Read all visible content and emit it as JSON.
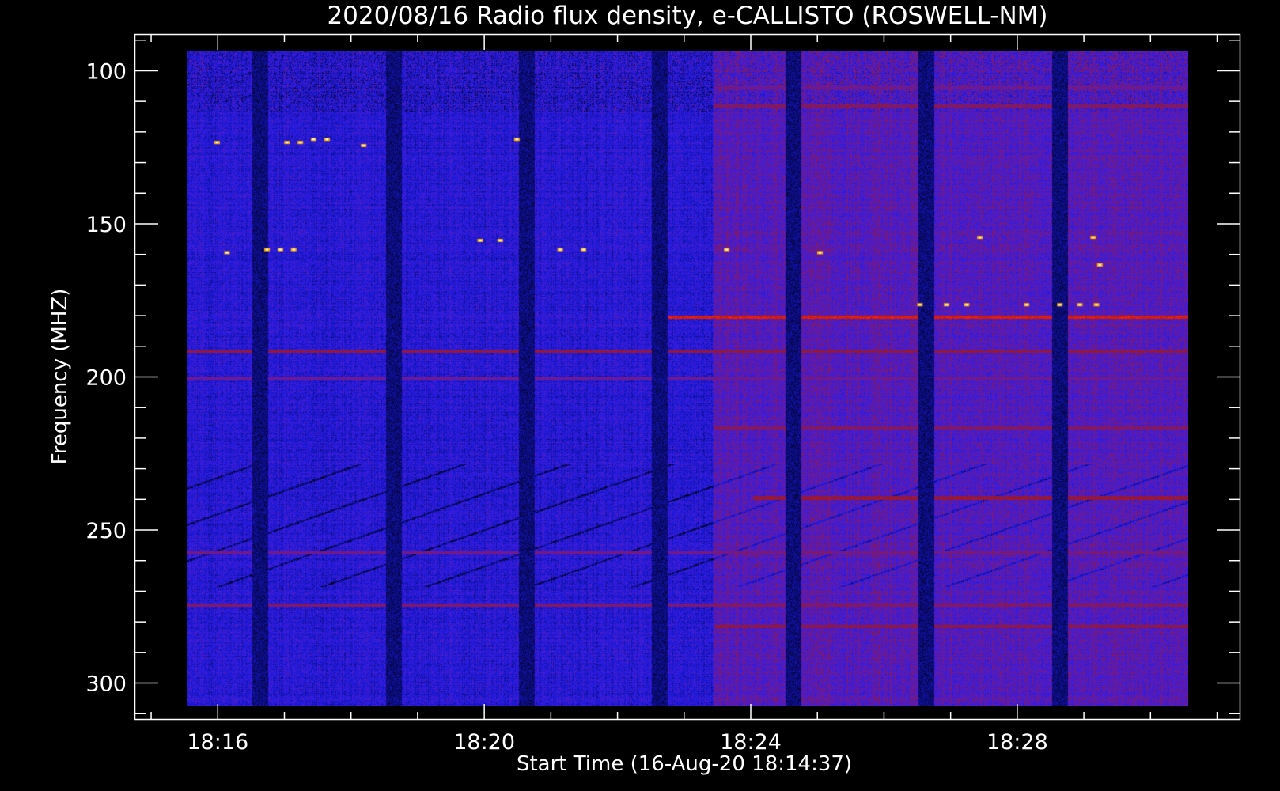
{
  "chart_data": {
    "type": "heatmap",
    "title": "2020/08/16  Radio flux density, e-CALLISTO (ROSWELL-NM)",
    "xlabel": "Start Time (16-Aug-20 18:14:37)",
    "ylabel": "Frequency (MHZ)",
    "xlim_minutes": [
      14.75,
      31.35
    ],
    "ylim_mhz": [
      88,
      312
    ],
    "data_range": {
      "t0_minutes": 15.0,
      "t1_minutes": 30.0,
      "f0_mhz": 90,
      "f1_mhz": 306
    },
    "x_ticks": [
      {
        "minute": 16,
        "label": "18:16"
      },
      {
        "minute": 20,
        "label": "18:20"
      },
      {
        "minute": 24,
        "label": "18:24"
      },
      {
        "minute": 28,
        "label": "18:28"
      }
    ],
    "x_minor_step_minutes": 1,
    "y_ticks": [
      {
        "mhz": 100,
        "label": "100"
      },
      {
        "mhz": 150,
        "label": "150"
      },
      {
        "mhz": 200,
        "label": "200"
      },
      {
        "mhz": 250,
        "label": "250"
      },
      {
        "mhz": 300,
        "label": "300"
      }
    ],
    "y_minor_step_mhz": 10,
    "colormap": [
      "#000000",
      "#0a0a6a",
      "#1818d8",
      "#3a1ee0",
      "#6a1aa0",
      "#a01818",
      "#ff2000",
      "#ffb000",
      "#ffffff"
    ],
    "background_intensity": {
      "before_minute": 22.9,
      "before": 0.3,
      "after": 0.44
    },
    "dropout_minutes": [
      16.1,
      18.1,
      20.1,
      22.1,
      24.1,
      26.1,
      28.1
    ],
    "rfi_lines_mhz": [
      {
        "mhz": 102,
        "intensity": 0.5,
        "from_minute": 22.9
      },
      {
        "mhz": 108,
        "intensity": 0.55,
        "from_minute": 22.9
      },
      {
        "mhz": 177,
        "intensity": 0.7,
        "from_minute": 22.2
      },
      {
        "mhz": 188,
        "intensity": 0.58,
        "from_minute": 15.0
      },
      {
        "mhz": 197,
        "intensity": 0.5,
        "from_minute": 15.0
      },
      {
        "mhz": 213,
        "intensity": 0.55,
        "from_minute": 22.9
      },
      {
        "mhz": 236,
        "intensity": 0.6,
        "from_minute": 23.5
      },
      {
        "mhz": 254,
        "intensity": 0.52,
        "from_minute": 15.0
      },
      {
        "mhz": 271,
        "intensity": 0.55,
        "from_minute": 15.0
      },
      {
        "mhz": 278,
        "intensity": 0.58,
        "from_minute": 22.9
      }
    ],
    "bright_spots": [
      {
        "minute": 15.45,
        "mhz": 120
      },
      {
        "minute": 16.5,
        "mhz": 120
      },
      {
        "minute": 16.7,
        "mhz": 120
      },
      {
        "minute": 16.9,
        "mhz": 119
      },
      {
        "minute": 17.1,
        "mhz": 119
      },
      {
        "minute": 17.65,
        "mhz": 121
      },
      {
        "minute": 19.95,
        "mhz": 119
      },
      {
        "minute": 19.4,
        "mhz": 152
      },
      {
        "minute": 19.7,
        "mhz": 152
      },
      {
        "minute": 16.2,
        "mhz": 155
      },
      {
        "minute": 16.4,
        "mhz": 155
      },
      {
        "minute": 16.6,
        "mhz": 155
      },
      {
        "minute": 15.6,
        "mhz": 156
      },
      {
        "minute": 20.6,
        "mhz": 155
      },
      {
        "minute": 20.95,
        "mhz": 155
      },
      {
        "minute": 23.1,
        "mhz": 155
      },
      {
        "minute": 24.5,
        "mhz": 156
      },
      {
        "minute": 26.9,
        "mhz": 151
      },
      {
        "minute": 28.6,
        "mhz": 151
      },
      {
        "minute": 28.7,
        "mhz": 160
      },
      {
        "minute": 26.0,
        "mhz": 173
      },
      {
        "minute": 26.4,
        "mhz": 173
      },
      {
        "minute": 26.7,
        "mhz": 173
      },
      {
        "minute": 27.6,
        "mhz": 173
      },
      {
        "minute": 28.1,
        "mhz": 173
      },
      {
        "minute": 28.4,
        "mhz": 173
      },
      {
        "minute": 28.65,
        "mhz": 173
      }
    ]
  }
}
